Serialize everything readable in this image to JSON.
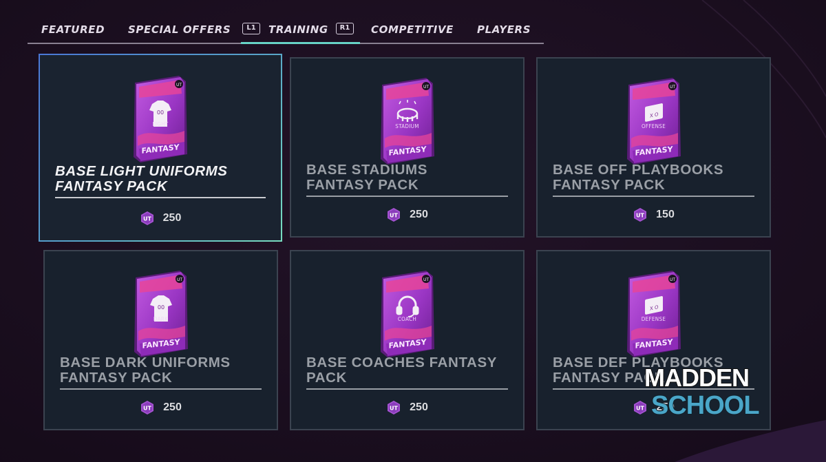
{
  "tabs": {
    "featured": "FEATURED",
    "special_offers": "SPECIAL OFFERS",
    "training": "TRAINING",
    "competitive": "COMPETITIVE",
    "players": "PLAYERS",
    "active": "TRAINING",
    "left_hint": "L1",
    "right_hint": "R1"
  },
  "packs": [
    {
      "title": "BASE LIGHT UNIFORMS\nFANTASY PACK",
      "type": "LIGHT",
      "badge": "FANTASY",
      "icon": "jersey-icon",
      "price": "250",
      "selected": true
    },
    {
      "title": "BASE STADIUMS\nFANTASY PACK",
      "type": "STADIUM",
      "badge": "FANTASY",
      "icon": "stadium-icon",
      "price": "250",
      "selected": false
    },
    {
      "title": "BASE OFF PLAYBOOKS\nFANTASY PACK",
      "type": "OFFENSE",
      "badge": "FANTASY",
      "icon": "playbook-icon",
      "price": "150",
      "selected": false
    },
    {
      "title": "BASE DARK UNIFORMS\nFANTASY PACK",
      "type": "DARK",
      "badge": "FANTASY",
      "icon": "jersey-icon",
      "price": "250",
      "selected": false
    },
    {
      "title": "BASE COACHES FANTASY\nPACK",
      "type": "COACH",
      "badge": "FANTASY",
      "icon": "headset-icon",
      "price": "250",
      "selected": false
    },
    {
      "title": "BASE DEF PLAYBOOKS\nFANTASY PACK",
      "type": "DEFENSE",
      "badge": "FANTASY",
      "icon": "playbook-icon",
      "price": "250",
      "selected": false
    }
  ],
  "watermark": {
    "line1": "MADDEN",
    "line2": "SCHOOL"
  },
  "colors": {
    "accent": "#67d3c6",
    "pack_purple": "#b23fd6",
    "pack_pink": "#e6449a",
    "coin": "#a553d2"
  }
}
